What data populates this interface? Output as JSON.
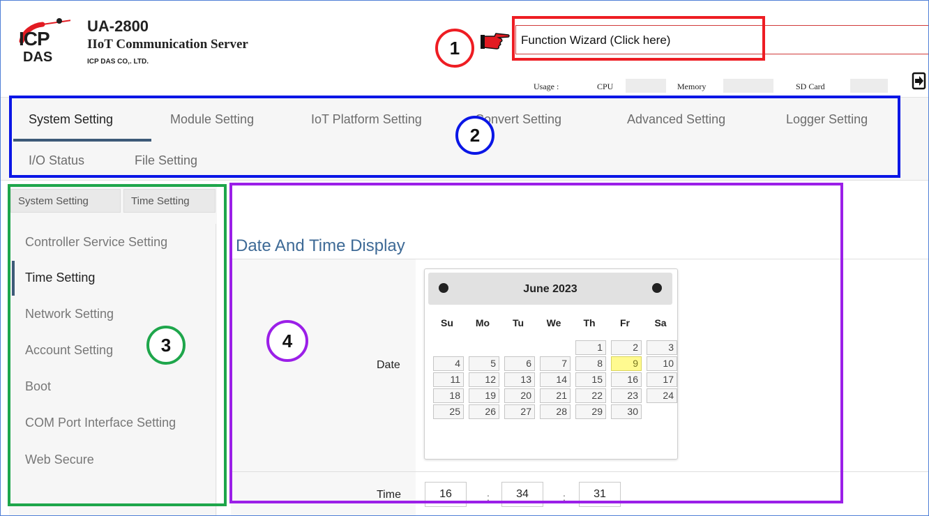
{
  "header": {
    "logo_line1": "ICP",
    "logo_line2": "DAS",
    "product_name": "UA-2800",
    "product_subtitle": "IIoT Communication Server",
    "company": "ICP DAS CO,. LTD.",
    "wizard_label": "Function Wizard  (Click here)",
    "usage_label": "Usage :",
    "usage_items": [
      "CPU",
      "Memory",
      "SD Card"
    ]
  },
  "tabs": [
    "System Setting",
    "Module Setting",
    "IoT Platform Setting",
    "Convert Setting",
    "Advanced Setting",
    "Logger Setting",
    "I/O Status",
    "File Setting"
  ],
  "breadcrumb": [
    "System Setting",
    "Time Setting"
  ],
  "sidebar": {
    "items": [
      "Controller Service Setting",
      "Time Setting",
      "Network Setting",
      "Account Setting",
      "Boot",
      "COM Port Interface Setting",
      "Web Secure"
    ],
    "active_index": 1
  },
  "main": {
    "title": "Date And Time Display",
    "date_label": "Date",
    "time_label": "Time"
  },
  "calendar": {
    "month_year": "June 2023",
    "weekdays": [
      "Su",
      "Mo",
      "Tu",
      "We",
      "Th",
      "Fr",
      "Sa"
    ],
    "rows": [
      [
        "",
        "",
        "",
        "",
        "1",
        "2",
        "3"
      ],
      [
        "4",
        "5",
        "6",
        "7",
        "8",
        "9",
        "10"
      ],
      [
        "11",
        "12",
        "13",
        "14",
        "15",
        "16",
        "17"
      ],
      [
        "18",
        "19",
        "20",
        "21",
        "22",
        "23",
        "24"
      ],
      [
        "25",
        "26",
        "27",
        "28",
        "29",
        "30",
        ""
      ]
    ],
    "selected_day": "9"
  },
  "time": {
    "hour": "16",
    "minute": "34",
    "second": "31",
    "separator": ":"
  },
  "callouts": [
    "1",
    "2",
    "3",
    "4"
  ],
  "colors": {
    "callout_1": "#ee1d23",
    "callout_2": "#0a16e6",
    "callout_3": "#1ea64b",
    "callout_4": "#9b1fe8",
    "accent": "#3d5a78",
    "title_blue": "#3e6a96",
    "today_bg": "#fffa90"
  }
}
